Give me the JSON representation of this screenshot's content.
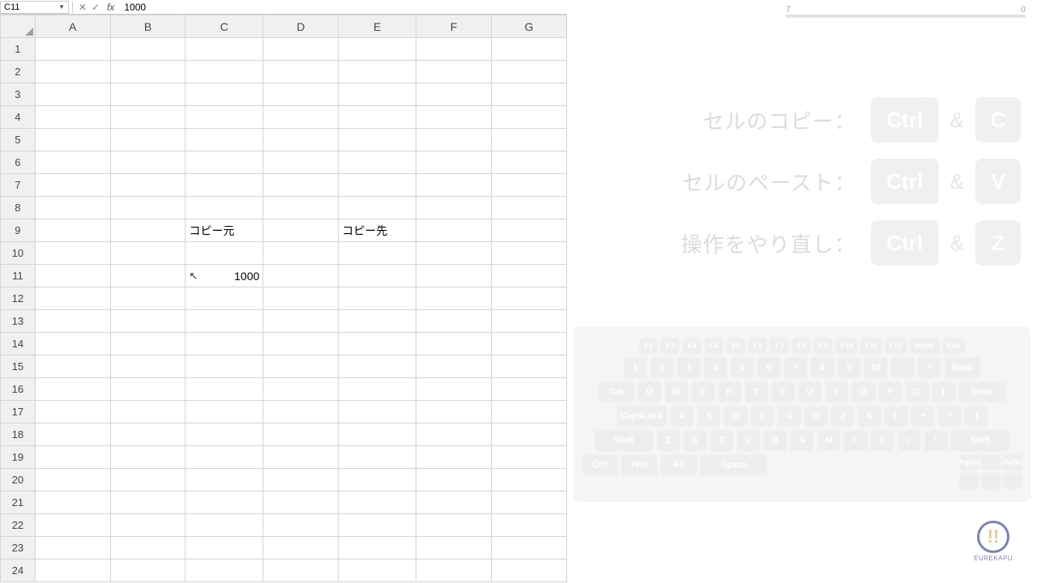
{
  "namebox": "C11",
  "formula_value": "1000",
  "columns": [
    "A",
    "B",
    "C",
    "D",
    "E",
    "F",
    "G"
  ],
  "row_count": 24,
  "cells": {
    "C9": "コピー元",
    "E9": "コピー先",
    "C11": "1000"
  },
  "timeline": {
    "left": "7",
    "right": "0"
  },
  "shortcuts": [
    {
      "label": "セルのコピー：",
      "k1": "Ctrl",
      "k2": "C"
    },
    {
      "label": "セルのペースト：",
      "k1": "Ctrl",
      "k2": "V"
    },
    {
      "label": "操作をやり直し：",
      "k1": "Ctrl",
      "k2": "Z"
    }
  ],
  "keyboard": {
    "r0": [
      "F1",
      "F2",
      "F3",
      "F4",
      "F5",
      "F6",
      "F7",
      "F8",
      "F9",
      "F10",
      "F11",
      "F12",
      "Home",
      "End"
    ],
    "r1": [
      "1",
      "2",
      "3",
      "4",
      "5",
      "6",
      "7",
      "8",
      "9",
      "10",
      "-",
      "^",
      "Back"
    ],
    "r2": [
      "Tab",
      "Q",
      "W",
      "E",
      "R",
      "T",
      "Y",
      "U",
      "I",
      "O",
      "P",
      "@",
      "[",
      "Enter"
    ],
    "r3": [
      "CapsLock",
      "A",
      "S",
      "D",
      "F",
      "G",
      "H",
      "J",
      "K",
      "L",
      "+",
      "*",
      "]"
    ],
    "r4": [
      "Shift",
      "Z",
      "X",
      "C",
      "V",
      "B",
      "N",
      "M",
      "<",
      ">",
      "/",
      "\\",
      "Shift"
    ],
    "r5": [
      "Ctrl",
      "Win",
      "Alt",
      "Space"
    ],
    "arrows": [
      "PgUp",
      "↑",
      "PgDn",
      "←",
      "↓",
      "→"
    ]
  },
  "logo": {
    "mark": "!!",
    "text": "EUREKAPU"
  }
}
